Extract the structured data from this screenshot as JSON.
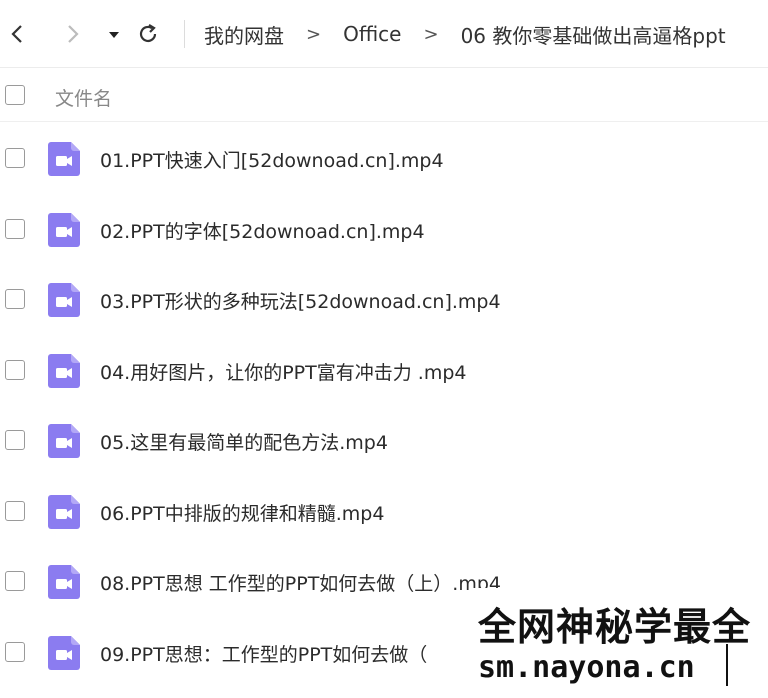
{
  "breadcrumb": {
    "items": [
      "我的网盘",
      "Office",
      "06 教你零基础做出高逼格ppt"
    ],
    "separator": ">"
  },
  "header": {
    "column_name": "文件名"
  },
  "files": [
    {
      "name": "01.PPT快速入门[52downoad.cn].mp4"
    },
    {
      "name": "02.PPT的字体[52downoad.cn].mp4"
    },
    {
      "name": "03.PPT形状的多种玩法[52downoad.cn].mp4"
    },
    {
      "name": "04.用好图片，让你的PPT富有冲击力 .mp4"
    },
    {
      "name": "05.这里有最简单的配色方法.mp4"
    },
    {
      "name": "06.PPT中排版的规律和精髓.mp4"
    },
    {
      "name": "08.PPT思想 工作型的PPT如何去做（上）.mp4"
    },
    {
      "name": "09.PPT思想：工作型的PPT如何去做（"
    }
  ],
  "watermark": {
    "line1": "全网神秘学最全",
    "line2": "sm.nayona.cn"
  },
  "colors": {
    "icon_purple": "#8b7cf0",
    "checkbox_border": "#9a9a9a"
  }
}
